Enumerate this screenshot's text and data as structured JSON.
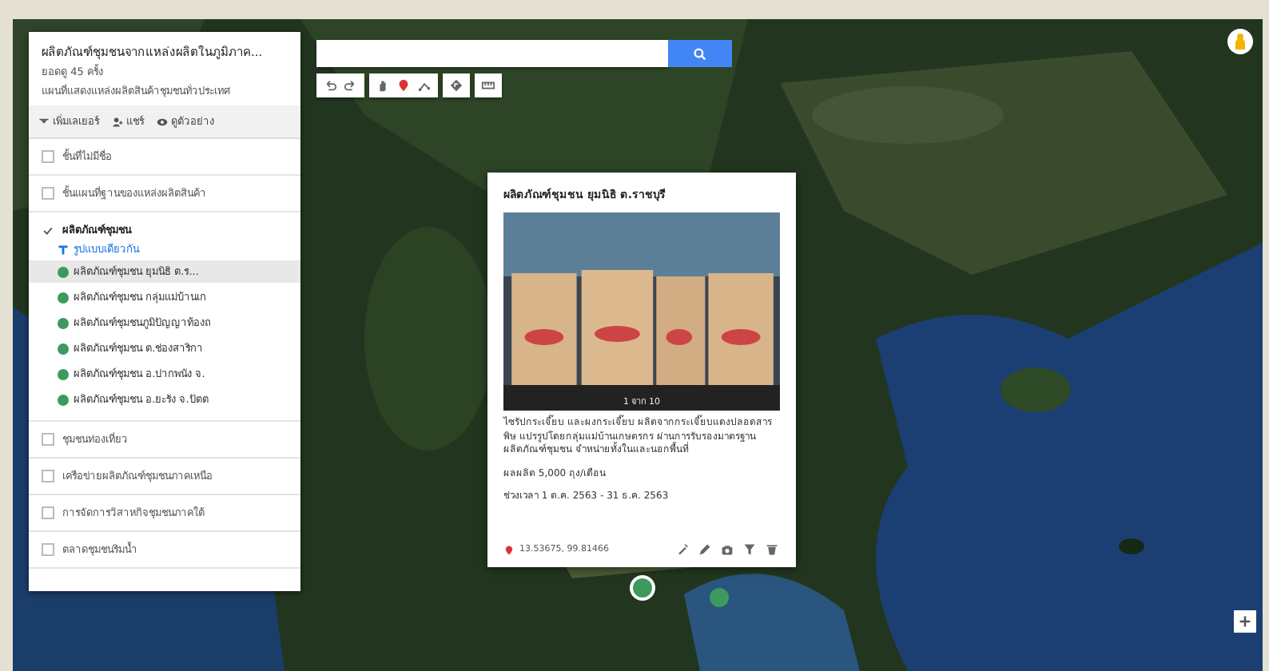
{
  "panel": {
    "title": "ผลิตภัณฑ์ชุมชนจากแหล่งผลิตในภูมิภาค...",
    "views": "ยอดดู 45 ครั้ง",
    "subtitle": "แผนที่แสดงแหล่งผลิตสินค้าชุมชนทั่วประเทศ",
    "actions": [
      {
        "kind": "add-layer",
        "label": "เพิ่มเลเยอร์"
      },
      {
        "kind": "share",
        "label": "แชร์"
      },
      {
        "kind": "preview",
        "label": "ดูตัวอย่าง"
      }
    ],
    "layers": [
      {
        "name": "ชั้นที่ไม่มีชื่อ",
        "checked": false
      },
      {
        "name": "ชั้นแผนที่ฐานของแหล่งผลิตสินค้า",
        "checked": false
      },
      {
        "name": "ผลิตภัณฑ์ชุมชน",
        "checked": true,
        "style": "รูปแบบเดียวกัน",
        "items": [
          {
            "label": "ผลิตภัณฑ์ชุมชน ยุมนิธิ ต.ร...",
            "selected": true
          },
          {
            "label": "ผลิตภัณฑ์ชุมชน กลุ่มแม่บ้านเก",
            "selected": false
          },
          {
            "label": "ผลิตภัณฑ์ชุมชนภูมิปัญญาท้องถ",
            "selected": false
          },
          {
            "label": "ผลิตภัณฑ์ชุมชน ต.ช่องสาริกา",
            "selected": false
          },
          {
            "label": "ผลิตภัณฑ์ชุมชน อ.ปากพนัง จ.",
            "selected": false
          },
          {
            "label": "ผลิตภัณฑ์ชุมชน อ.ยะรัง จ.ปัตต",
            "selected": false
          }
        ]
      },
      {
        "name": "ชุมชนท่องเที่ยว",
        "checked": false
      },
      {
        "name": "เครือข่ายผลิตภัณฑ์ชุมชนภาคเหนือ",
        "checked": false
      },
      {
        "name": "การจัดการวิสาหกิจชุมชนภาคใต้",
        "checked": false
      },
      {
        "name": "ตลาดชุมชนริมน้ำ",
        "checked": false
      }
    ]
  },
  "toolbar": [
    {
      "kind": "undo"
    },
    {
      "kind": "redo"
    },
    {
      "kind": "hand"
    },
    {
      "kind": "marker"
    },
    {
      "kind": "line"
    },
    {
      "kind": "directions"
    },
    {
      "kind": "ruler"
    }
  ],
  "popup": {
    "title": "ผลิตภัณฑ์ชุมชน ยุมนิธิ ต.ราชบุรี",
    "photo": {
      "kind": "picture",
      "caption": "1 จาก 10"
    },
    "description": "ไซรัปกระเจี๊ยบ และผงกระเจี๊ยบ ผลิตจากกระเจี๊ยบแดงปลอดสารพิษ แปรรูปโดยกลุ่มแม่บ้านเกษตรกร ผ่านการรับรองมาตรฐานผลิตภัณฑ์ชุมชน จำหน่ายทั้งในและนอกพื้นที่",
    "capacity": "ผลผลิต 5,000 ถุง/เดือน",
    "period": "ช่วงเวลา 1 ต.ค. 2563 - 31 ธ.ค. 2563",
    "coords": "13.53675, 99.81466",
    "actions": [
      {
        "kind": "style"
      },
      {
        "kind": "edit"
      },
      {
        "kind": "camera"
      },
      {
        "kind": "filter"
      },
      {
        "kind": "delete"
      }
    ]
  },
  "pins": [
    {
      "selected": true
    },
    {
      "selected": false
    }
  ]
}
